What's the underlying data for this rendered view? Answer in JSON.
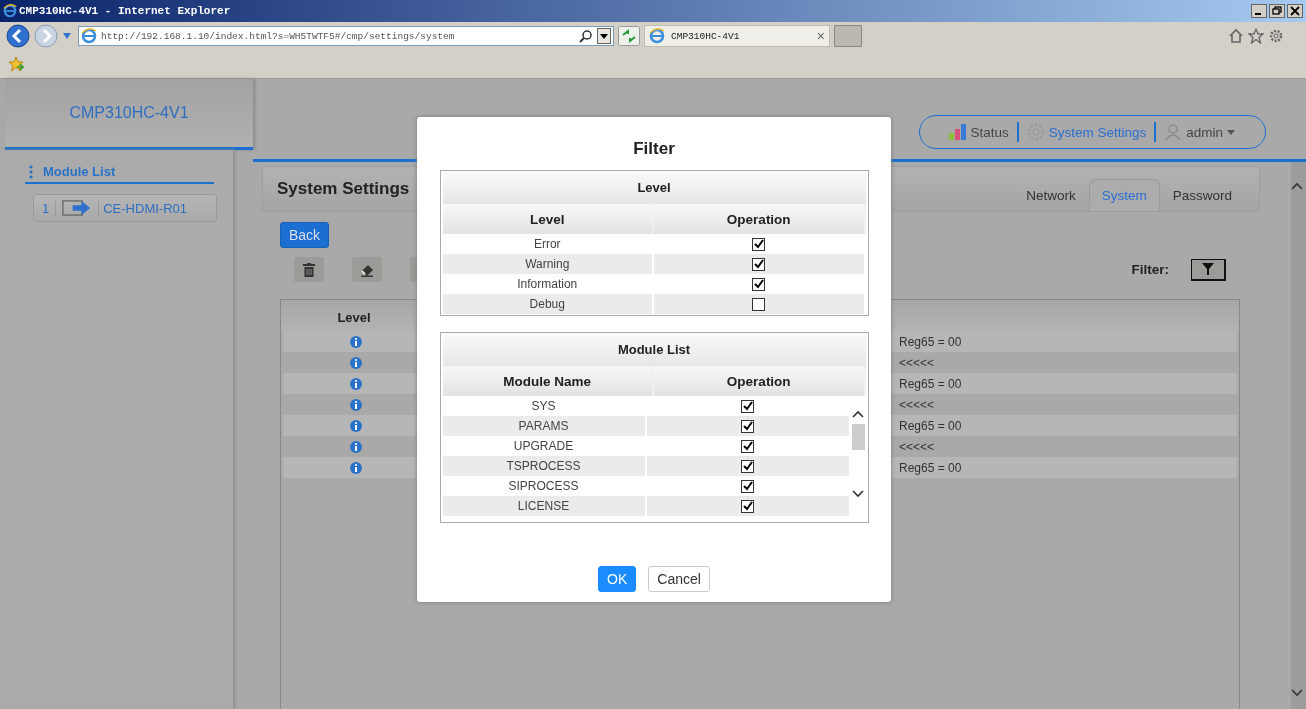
{
  "browser": {
    "title": "CMP310HC-4V1 - Internet Explorer",
    "address": "http://192.168.1.10/index.html?s=WH5TWTF5#/cmp/settings/system",
    "tab": "CMP310HC-4V1",
    "tab_close": "×"
  },
  "brand": "CMP310HC-4V1",
  "nav": [
    {
      "kind": "status",
      "label": "Status",
      "selected": false
    },
    {
      "kind": "settings",
      "label": "System Settings",
      "selected": true
    },
    {
      "kind": "user",
      "label": "admin",
      "selected": false
    }
  ],
  "sidebar": {
    "title": "Module List",
    "items": [
      {
        "index": "1",
        "label": "CE-HDMI-R01"
      }
    ]
  },
  "page": {
    "title": "System Settings",
    "tabs": [
      {
        "label": "Network",
        "selected": false
      },
      {
        "label": "System",
        "selected": true
      },
      {
        "label": "Password",
        "selected": false
      }
    ],
    "back": "Back",
    "filter_label": "Filter:"
  },
  "log_table": {
    "columns": [
      "Level"
    ],
    "rows": [
      {
        "kind": "info",
        "message": "Reg65 = 00"
      },
      {
        "kind": "info",
        "message": "<<<<<"
      },
      {
        "kind": "info",
        "message": "Reg65 = 00"
      },
      {
        "kind": "info",
        "message": "<<<<<"
      },
      {
        "kind": "info",
        "message": "Reg65 = 00"
      },
      {
        "kind": "info",
        "message": "<<<<<"
      },
      {
        "kind": "info",
        "message": "Reg65 = 00"
      }
    ]
  },
  "dialog": {
    "title": "Filter",
    "level_table": {
      "caption": "Level",
      "columns": [
        "Level",
        "Operation"
      ],
      "rows": [
        {
          "name": "Error",
          "checked": true
        },
        {
          "name": "Warning",
          "checked": true
        },
        {
          "name": "Information",
          "checked": true
        },
        {
          "name": "Debug",
          "checked": false
        }
      ]
    },
    "module_table": {
      "caption": "Module List",
      "columns": [
        "Module Name",
        "Operation"
      ],
      "rows": [
        {
          "name": "SYS",
          "checked": true
        },
        {
          "name": "PARAMS",
          "checked": true
        },
        {
          "name": "UPGRADE",
          "checked": true
        },
        {
          "name": "TSPROCESS",
          "checked": true
        },
        {
          "name": "SIPROCESS",
          "checked": true
        },
        {
          "name": "LICENSE",
          "checked": true
        }
      ]
    },
    "buttons": [
      {
        "kind": "primary",
        "label": "OK"
      },
      {
        "kind": "default",
        "label": "Cancel"
      }
    ]
  }
}
